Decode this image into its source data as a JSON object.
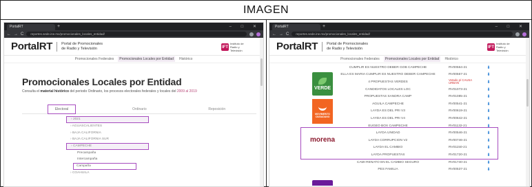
{
  "header": {
    "title": "IMAGEN"
  },
  "browser": {
    "tab_label": "PortalRT",
    "new_tab": "+",
    "window_controls": "– □ ✕",
    "url": "reportes.sede.ine.mx/promocionales_locales_entidad/",
    "nav": {
      "back": "←",
      "forward": "→",
      "reload": "C"
    }
  },
  "site": {
    "logo": "PortalRT",
    "subtitle": "Portal de Promocionales de Radio y Televisión",
    "ift_mark": "IFT",
    "ift_text": "Instituto de Radio y Televisión",
    "tabs": [
      "Promocionales Federales",
      "Promocionales Locales por Entidad",
      "Histórico"
    ]
  },
  "left_page": {
    "title": "Promocionales Locales por Entidad",
    "desc_prefix": "Consulta el ",
    "desc_bold": "material histórico",
    "desc_middle": " del periodo Ordinario, los procesos electorales federales y locales del ",
    "desc_years": "2009 al 2019",
    "filters": [
      "Electoral",
      "Ordinario",
      "Reposición"
    ],
    "tree": [
      "2021",
      "AGUASCALIENTES",
      "BAJA CALIFORNIA",
      "BAJA CALIFORNIA SUR",
      "CAMPECHE",
      "Precampaña",
      "Intercampaña",
      "Campaña",
      "COAHUILA"
    ]
  },
  "right_page": {
    "rows": [
      {
        "name": "CUMPLIR ES NUESTRO DEBER GOB CAMPECHE",
        "folio": "RV00564-21"
      },
      {
        "name": "ELLA ES MARÍA CUMPLIR ES NUESTRO DEBER CAMPECHE",
        "folio": "RV00567-21"
      },
      {
        "name": "4 PROPUESTAS VERDES",
        "folio": "Vetado p/ CAUSA URBAN"
      },
      {
        "name": "CANDIDATOS LOCALES LOC",
        "folio": "RV01073-21"
      },
      {
        "name": "PROPUESTAS SANDRA CAMP",
        "folio": "RV01085-21"
      },
      {
        "name": "ÁGUILA CAMPECHE",
        "folio": "RV00541-21"
      },
      {
        "name": "LAYDA ES DEL PRI V3",
        "folio": "RV00619-21"
      },
      {
        "name": "LAYDA ES DEL PRI V4",
        "folio": "RV00642-21"
      },
      {
        "name": "EUGEO BOX CAMPECHE",
        "folio": "RV01132-21"
      },
      {
        "name": "LAYDA UNIDAD",
        "folio": "RV00546-21"
      },
      {
        "name": "LAYDA CORRUPCIÓN V2",
        "folio": "RV00746-21"
      },
      {
        "name": "LAYDA EL CAMBIO",
        "folio": "RV01150-21"
      },
      {
        "name": "LAYDA PROPUESTAS",
        "folio": "RV01720-21"
      },
      {
        "name": "CAMI RENATO EN EL CAMBIO SEGURO",
        "folio": "RV01740-21"
      },
      {
        "name": "PES FAMILIA",
        "folio": "RV00537-21"
      }
    ],
    "download_glyph": "⬇",
    "parties": {
      "verde": "VERDE",
      "mc": "MOVIMIENTO CIUDADANO",
      "morena": "morena"
    }
  }
}
